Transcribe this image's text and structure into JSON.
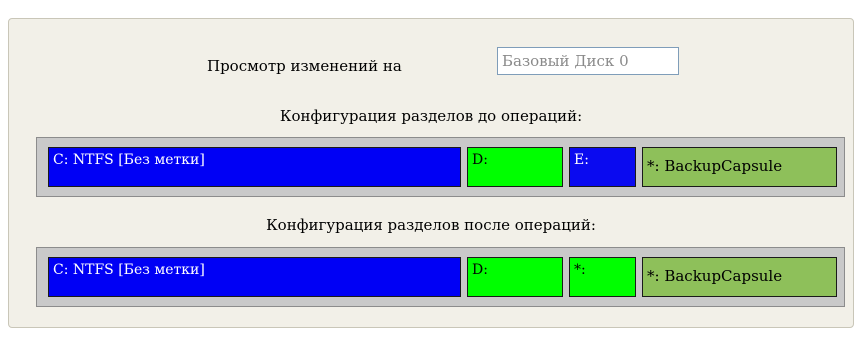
{
  "view": {
    "label": "Просмотр изменений на",
    "disk_value": "Базовый Диск 0"
  },
  "before": {
    "title": "Конфигурация разделов до операций:",
    "partitions": [
      {
        "label": "C: NTFS [Без метки]",
        "color": "#0000f5"
      },
      {
        "label": "D:",
        "color": "#00ff00"
      },
      {
        "label": "E:",
        "color": "#0a0af0"
      },
      {
        "label": "*: BackupCapsule",
        "color": "#8ec05a"
      }
    ]
  },
  "after": {
    "title": "Конфигурация разделов после операций:",
    "partitions": [
      {
        "label": "C: NTFS [Без метки]",
        "color": "#0000f5"
      },
      {
        "label": "D:",
        "color": "#00ff00"
      },
      {
        "label": "*:",
        "color": "#00ff00"
      },
      {
        "label": "*: BackupCapsule",
        "color": "#8ec05a"
      }
    ]
  }
}
